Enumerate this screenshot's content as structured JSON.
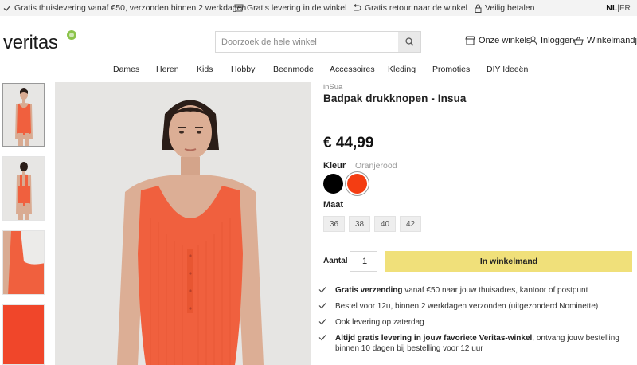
{
  "topbar": {
    "usps": [
      {
        "icon": "check-icon",
        "text": "Gratis thuislevering vanaf €50, verzonden binnen 2 werkdagen"
      },
      {
        "icon": "store-icon",
        "text": "Gratis levering in de winkel"
      },
      {
        "icon": "return-icon",
        "text": "Gratis retour naar de winkel"
      },
      {
        "icon": "lock-icon",
        "text": "Veilig betalen"
      }
    ],
    "lang_active": "NL",
    "lang_sep": "|",
    "lang_other": "FR"
  },
  "header": {
    "logo": "veritas",
    "search_placeholder": "Doorzoek de hele winkel",
    "links": {
      "stores": "Onze winkels",
      "login": "Inloggen",
      "cart": "Winkelmandje"
    }
  },
  "nav": [
    "Dames",
    "Heren",
    "Kids",
    "Hobby",
    "Beenmode",
    "Accessoires",
    "Kleding",
    "Promoties",
    "DIY Ideeën"
  ],
  "product": {
    "brand": "inSua",
    "title": "Badpak drukknopen - Insua",
    "price": "€ 44,99",
    "color_label": "Kleur",
    "color_selected": "Oranjerood",
    "colors": [
      "#000000",
      "#f43d12"
    ],
    "size_label": "Maat",
    "sizes": [
      "36",
      "38",
      "40",
      "42"
    ],
    "qty_label": "Aantal",
    "qty_value": "1",
    "cart_button": "In winkelmand"
  },
  "usps_list": [
    {
      "bold": "Gratis verzending",
      "text": " vanaf €50 naar jouw thuisadres, kantoor of postpunt"
    },
    {
      "bold": "",
      "text": "Bestel voor 12u, binnen 2 werkdagen verzonden (uitgezonderd Nominette)"
    },
    {
      "bold": "",
      "text": "Ook levering op zaterdag"
    },
    {
      "bold": "Altijd gratis levering in jouw favoriete Veritas-winkel",
      "text": ", ontvang jouw bestelling binnen 10 dagen bij bestelling voor 12 uur"
    }
  ],
  "colors": {
    "accent_yellow": "#f0e07a",
    "logo_green": "#8bc34a",
    "swimsuit": "#f0603e"
  }
}
